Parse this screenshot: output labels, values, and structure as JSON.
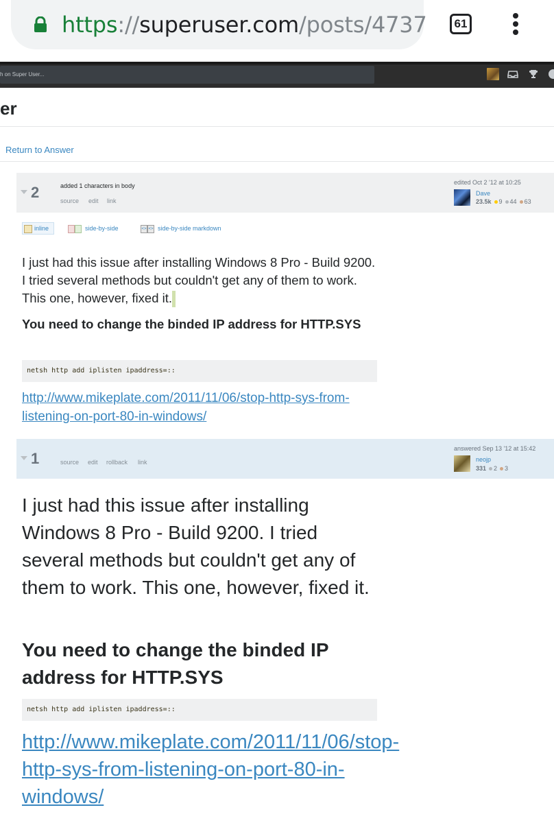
{
  "browser": {
    "url_scheme": "https",
    "url_sep": "://",
    "url_host": "superuser.com",
    "url_path": "/posts/4737",
    "tab_count": "61"
  },
  "topbar": {
    "search_placeholder": "h on Super User..."
  },
  "page": {
    "site_title": "er",
    "return_link": "Return to Answer"
  },
  "revisions": [
    {
      "number": "2",
      "comment": "added 1 characters in body",
      "actions": [
        "source",
        "edit",
        "link"
      ],
      "signature": {
        "action": "edited Oct 2 '12 at 10:25",
        "user": "Dave",
        "rep": "23.5k",
        "gold": "9",
        "silver": "44",
        "bronze": "63"
      },
      "modes": [
        "inline",
        "side-by-side",
        "side-by-side markdown"
      ],
      "body": {
        "paragraph": "I just had this issue after installing Windows 8 Pro - Build 9200. I tried several methods but couldn't get any of them to work. This one, however, fixed it.",
        "heading": "You need to change the binded IP address for HTTP.SYS",
        "code": "netsh http add iplisten ipaddress=::",
        "link": "http://www.mikeplate.com/2011/11/06/stop-http-sys-from-listening-on-port-80-in-windows/"
      }
    },
    {
      "number": "1",
      "actions": [
        "source",
        "edit",
        "rollback",
        "link"
      ],
      "signature": {
        "action": "answered Sep 13 '12 at 15:42",
        "user": "neojp",
        "rep": "331",
        "silver": "2",
        "bronze": "3"
      },
      "body": {
        "paragraph": "I just had this issue after installing Windows 8 Pro - Build 9200. I tried several methods but couldn't get any of them to work. This one, however, fixed it.",
        "heading": "You need to change the binded IP address for HTTP.SYS",
        "code": "netsh http add iplisten ipaddress=::",
        "link": "http://www.mikeplate.com/2011/11/06/stop-http-sys-from-listening-on-port-80-in-windows/"
      }
    }
  ],
  "colors": {
    "gold": "#ffcc01",
    "silver": "#b4b8bc",
    "bronze": "#d1a684",
    "link": "#3a87c0"
  }
}
